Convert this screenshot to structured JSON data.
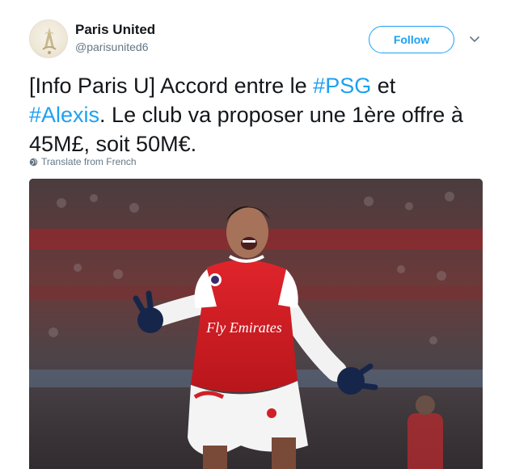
{
  "tweet": {
    "display_name": "Paris United",
    "handle": "@parisunited6",
    "follow_label": "Follow",
    "text": {
      "part1": "[Info Paris U] Accord entre le ",
      "hashtag1": "#PSG",
      "part2": " et ",
      "hashtag2": "#Alexis",
      "part3": ". Le club va proposer une 1ère offre à 45M£, soit 50M€."
    },
    "translate_label": "Translate from French",
    "media": {
      "description_icon": "photo",
      "shirt_text": "Fly Emirates"
    }
  },
  "colors": {
    "accent": "#1da1f2",
    "secondary_text": "#657786",
    "primary_text": "#14171a"
  },
  "icons": {
    "caret": "chevron-down-icon",
    "translate": "globe-icon"
  }
}
